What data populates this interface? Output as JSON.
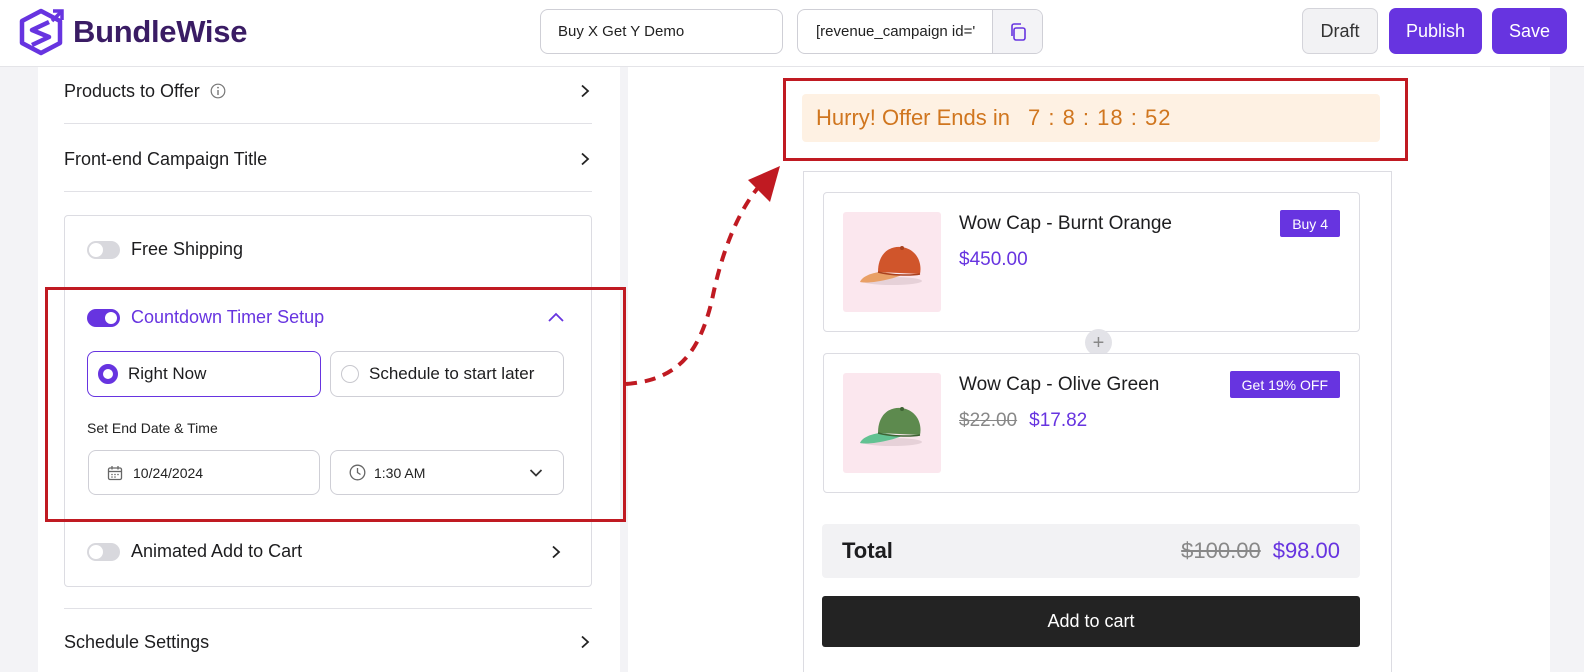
{
  "header": {
    "brand": "BundleWise",
    "campaign_name": "Buy X Get Y Demo",
    "shortcode": "[revenue_campaign id='",
    "draft_label": "Draft",
    "publish_label": "Publish",
    "save_label": "Save",
    "accent_color": "#6734e0"
  },
  "sidebar": {
    "products_to_offer": "Products to Offer",
    "frontend_title": "Front-end Campaign Title",
    "free_shipping": {
      "label": "Free Shipping",
      "enabled": false
    },
    "countdown": {
      "label": "Countdown Timer Setup",
      "enabled": true,
      "option_now": "Right Now",
      "option_later": "Schedule to start later",
      "selected": "Right Now",
      "end_label": "Set End Date & Time",
      "date_value": "10/24/2024",
      "time_value": "1:30 AM"
    },
    "animated_cart": {
      "label": "Animated Add to Cart",
      "enabled": false
    },
    "schedule_settings": "Schedule Settings"
  },
  "preview": {
    "countdown_text": "Hurry! Offer Ends in",
    "countdown_time": "7 : 8 : 18 : 52",
    "products": [
      {
        "name": "Wow Cap - Burnt Orange",
        "price": "$450.00",
        "old_price": "",
        "badge": "Buy 4",
        "color": "burnt-orange"
      },
      {
        "name": "Wow Cap - Olive Green",
        "price": "$17.82",
        "old_price": "$22.00",
        "badge": "Get 19% OFF",
        "color": "olive-green"
      }
    ],
    "total_label": "Total",
    "total_old": "$100.00",
    "total_new": "$98.00",
    "add_to_cart": "Add to cart"
  }
}
